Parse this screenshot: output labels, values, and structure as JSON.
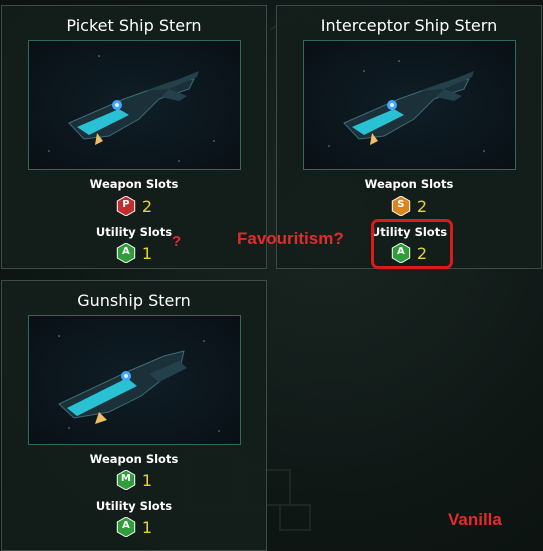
{
  "cards": [
    {
      "title": "Picket Ship Stern",
      "weapon": {
        "label": "Weapon Slots",
        "badge": "P",
        "badge_color": "#c42d2d",
        "count": "2"
      },
      "utility": {
        "label": "Utility Slots",
        "badge": "A",
        "badge_color": "#2f9e3a",
        "count": "1"
      }
    },
    {
      "title": "Interceptor Ship Stern",
      "weapon": {
        "label": "Weapon Slots",
        "badge": "S",
        "badge_color": "#d9861e",
        "count": "2"
      },
      "utility": {
        "label": "Utility Slots",
        "badge": "A",
        "badge_color": "#2f9e3a",
        "count": "2"
      }
    },
    {
      "title": "Gunship Stern",
      "weapon": {
        "label": "Weapon Slots",
        "badge": "M",
        "badge_color": "#2f9e3a",
        "count": "1"
      },
      "utility": {
        "label": "Utility Slots",
        "badge": "A",
        "badge_color": "#2f9e3a",
        "count": "1"
      }
    }
  ],
  "annotations": {
    "question_mark": "?",
    "favouritism": "Favouritism?",
    "vanilla": "Vanilla",
    "color": "#e22b2b"
  }
}
